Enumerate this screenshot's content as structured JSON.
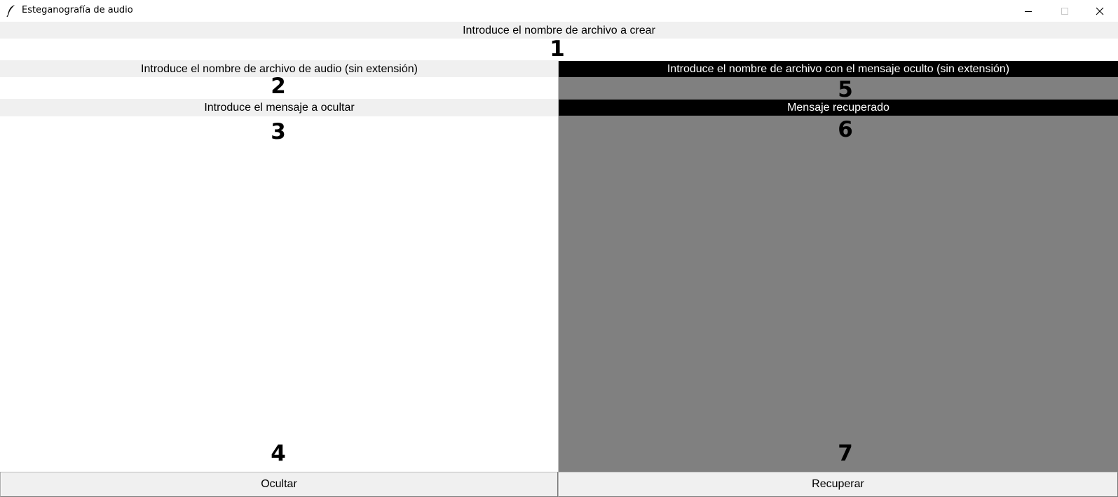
{
  "window": {
    "title": "Esteganografía de audio",
    "icon": "feather-icon",
    "controls": [
      "minimize-icon",
      "maximize-icon",
      "close-icon"
    ]
  },
  "top": {
    "label": "Introduce el nombre de archivo a crear",
    "marker": "1",
    "value": ""
  },
  "left": {
    "audio_label": "Introduce el nombre de archivo de audio (sin extensión)",
    "audio_marker": "2",
    "audio_value": "",
    "message_label": "Introduce el mensaje a ocultar",
    "message_marker": "3",
    "message_value": "",
    "bottom_marker": "4",
    "button": "Ocultar"
  },
  "right": {
    "file_label": "Introduce el nombre de archivo con el mensaje oculto (sin extensión)",
    "file_marker": "5",
    "file_value": "",
    "recovered_label": "Mensaje recuperado",
    "recovered_marker": "6",
    "recovered_value": "",
    "bottom_marker": "7",
    "button": "Recuperar"
  },
  "colors": {
    "dark_label_bg": "#000000",
    "gray_panel": "#808080",
    "light_bg": "#f0f0f0",
    "entry_bg": "#ffffff"
  }
}
